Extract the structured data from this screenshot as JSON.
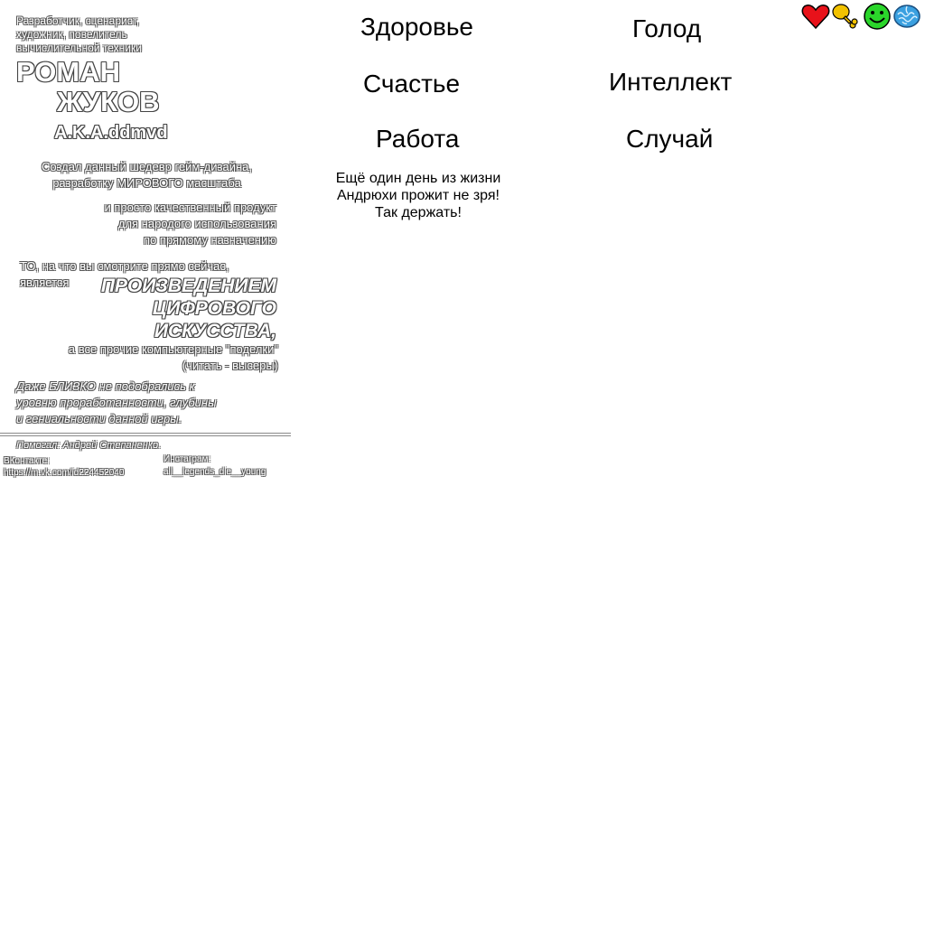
{
  "credits": {
    "intro": [
      "Разработчик, сценарист,",
      "художник, повелитель",
      "вычислительной техники"
    ],
    "first_name": "РОМАН",
    "last_name": "ЖУКОВ",
    "aka": "A.K.A.ddmvd",
    "created": [
      "Создал данный шедевр гейм-дизайна,",
      "разработку МИРОВОГО масштаба"
    ],
    "quality": [
      "и просто качественный продукт",
      "для народого использования",
      "по прямому назначению"
    ],
    "to_line1": "ТО, на что вы смотрите прямо сейчас,",
    "to_line2": "является",
    "art": [
      "ПРОИЗВЕДЕНИЕМ",
      "ЦИФРОВОГО",
      "ИСКУССТВА,"
    ],
    "others": [
      "а все прочие компьютерные \"поделки\"",
      "(читать - высеры)"
    ],
    "closing": [
      "Даже БЛИЗКО не подобрались к",
      "уровню проработанности, глубины",
      "и гениальности данной игры."
    ],
    "helper": "Помогал: Андрей Степаненко.",
    "vk_label": "ВКонтакте:",
    "vk_value": "https://m.vk.com/id224452040",
    "instagram_label": "Инстаграм:",
    "instagram_value": "all__legends_die__young"
  },
  "stats": {
    "health": "Здоровье",
    "hunger": "Голод",
    "happiness": "Счастье",
    "intellect": "Интеллект",
    "work": "Работа",
    "chance": "Случай"
  },
  "message": [
    "Ещё один день из жизни",
    "Андрюхи прожит не зря!",
    "Так держать!"
  ],
  "icons": {
    "health": "heart-icon",
    "hunger": "drumstick-icon",
    "happiness": "smiley-icon",
    "intellect": "brain-icon"
  },
  "colors": {
    "heart": "#e8121a",
    "drumstick": "#f2c200",
    "smiley": "#2bd62b",
    "brain": "#3aa0e0"
  }
}
